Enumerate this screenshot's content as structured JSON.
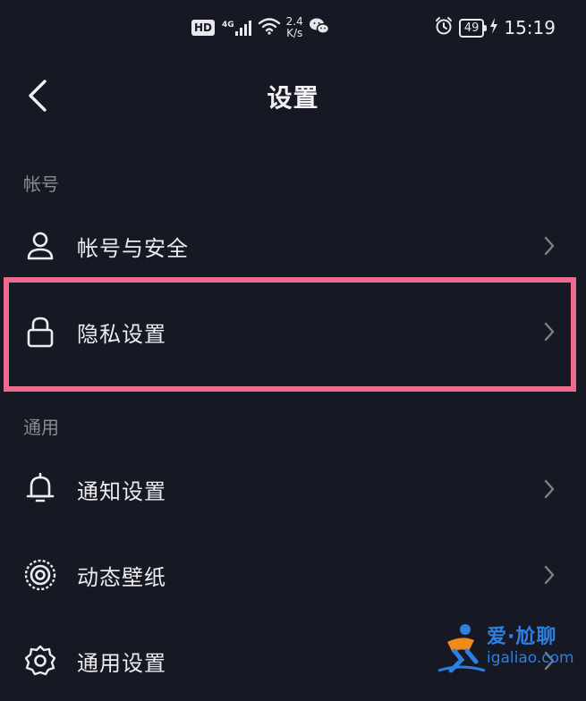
{
  "status_bar": {
    "hd_badge": "HD",
    "network_type": "4G",
    "speed_value": "2.4",
    "speed_unit": "K/s",
    "battery_level": "49",
    "time": "15:19"
  },
  "nav": {
    "title": "设置"
  },
  "sections": {
    "account": {
      "header": "帐号",
      "items": [
        {
          "label": "帐号与安全",
          "icon": "user-icon"
        },
        {
          "label": "隐私设置",
          "icon": "lock-icon"
        }
      ]
    },
    "general": {
      "header": "通用",
      "items": [
        {
          "label": "通知设置",
          "icon": "bell-icon"
        },
        {
          "label": "动态壁纸",
          "icon": "live-wallpaper-icon"
        },
        {
          "label": "通用设置",
          "icon": "gear-icon"
        }
      ]
    }
  },
  "colors": {
    "background": "#161823",
    "highlight_border": "#ee6b8e",
    "section_header": "#8a8b91",
    "watermark": "#2f7fe0",
    "watermark_accent": "#f08a1c"
  },
  "watermark": {
    "title": "爱·尬聊",
    "url": "igaliao.com"
  }
}
